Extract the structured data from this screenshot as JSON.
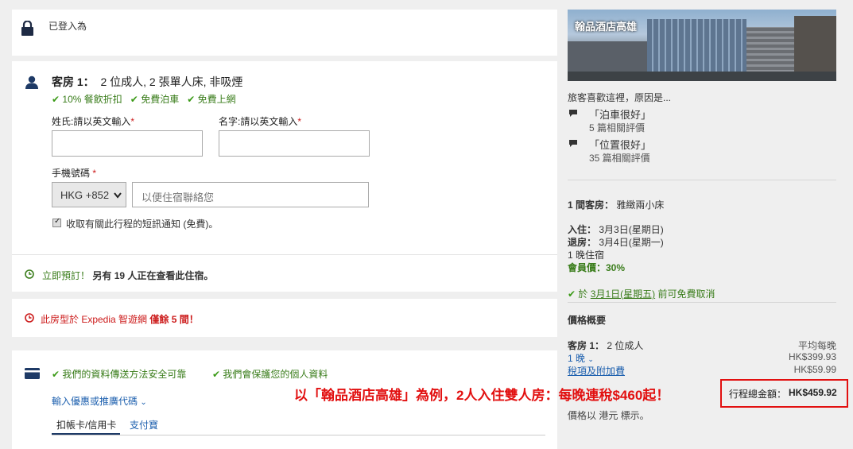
{
  "login": {
    "text": "已登入為"
  },
  "room": {
    "title_label": "客房 1：",
    "title_value": "2 位成人, 2 張單人床, 非吸煙",
    "perks": [
      "10% 餐飲折扣",
      "免費泊車",
      "免費上網"
    ],
    "surname_label": "姓氏:請以英文輸入",
    "given_label": "名字:請以英文輸入",
    "required_mark": "*",
    "phone_label": "手機號碼",
    "country_code": "HKG +852",
    "phone_placeholder": "以便住宿聯絡您",
    "sms_text": "收取有關此行程的短訊通知 (免費)。",
    "book_now_prefix": "立即預訂！",
    "book_now_bold": "另有 19 人正在查看此住宿。"
  },
  "urgency": {
    "text_prefix": "此房型於 Expedia 智遊網 ",
    "text_bold": "僅餘 5 間！"
  },
  "payment": {
    "secure1": "我們的資料傳送方法安全可靠",
    "secure2": "我們會保護您的個人資料",
    "promo": "輸入優惠或推廣代碼",
    "tabs": [
      "扣帳卡/信用卡",
      "支付寶"
    ]
  },
  "sidebar": {
    "hotel_name": "翰品酒店高雄",
    "reviews_heading": "旅客喜歡這裡，原因是...",
    "reviews": [
      {
        "title": "「泊車很好」",
        "count": "5 篇相關評價"
      },
      {
        "title": "「位置很好」",
        "count": "35 篇相關評價"
      }
    ],
    "rooms_label": "1 間客房：",
    "rooms_value": "雅緻兩小床",
    "checkin_label": "入住：",
    "checkin_value": "3月3日(星期日)",
    "checkout_label": "退房：",
    "checkout_value": "3月4日(星期一)",
    "nights": "1 晚住宿",
    "member_price": "會員價：30%",
    "cancel_prefix": "於",
    "cancel_date": "3月1日(星期五)",
    "cancel_suffix": "前可免費取消",
    "price_summary": "價格概要",
    "room_label": "客房 1：",
    "room_guests": "2 位成人",
    "avg_label": "平均每晚",
    "night_link": "1 晚",
    "night_price": "HK$399.93",
    "tax_link": "稅項及附加費",
    "tax_price": "HK$59.99",
    "total_label": "行程總金額：",
    "total_value": "HK$459.92",
    "currency_note": "價格以 港元 標示。"
  },
  "annotation": "以「翰品酒店高雄」為例，2人入住雙人房：每晚連稅$460起！",
  "colors": {
    "accent": "#1c5fae",
    "green": "#3a7d1b",
    "red": "#cc1a1a",
    "annotation": "#e21010"
  }
}
